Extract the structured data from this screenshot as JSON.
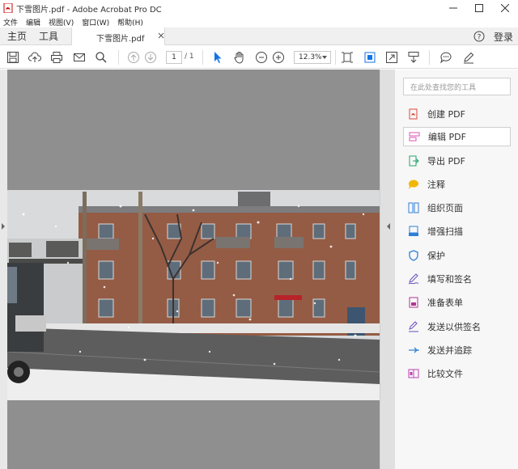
{
  "window": {
    "title": "下雪图片.pdf - Adobe Acrobat Pro DC"
  },
  "menu": [
    "文件",
    "编辑",
    "视图(V)",
    "窗口(W)",
    "帮助(H)"
  ],
  "tabs": {
    "home": "主页",
    "tools": "工具",
    "document": "下雪图片.pdf",
    "login": "登录"
  },
  "toolbar": {
    "current_page": "1",
    "total_pages": "/ 1",
    "zoom": "12.3%"
  },
  "tools_pane": {
    "search_placeholder": "在此处查找您的工具",
    "items": [
      {
        "label": "创建 PDF",
        "color": "#e0463b"
      },
      {
        "label": "编辑 PDF",
        "color": "#d854b4"
      },
      {
        "label": "导出 PDF",
        "color": "#27a36f"
      },
      {
        "label": "注释",
        "color": "#f2b705"
      },
      {
        "label": "组织页面",
        "color": "#2f7fd6"
      },
      {
        "label": "增强扫描",
        "color": "#2f7fd6"
      },
      {
        "label": "保护",
        "color": "#2f7fd6"
      },
      {
        "label": "填写和签名",
        "color": "#6a4fbf"
      },
      {
        "label": "准备表单",
        "color": "#b2368f"
      },
      {
        "label": "发送以供签名",
        "color": "#6a4fbf"
      },
      {
        "label": "发送并追踪",
        "color": "#2f7fd6"
      },
      {
        "label": "比较文件",
        "color": "#c23fb5"
      }
    ]
  },
  "document": {
    "image_description_icon": "snowy-street-photo",
    "sign_text": "□□□□□"
  },
  "colors": {
    "accent": "#1473e6",
    "doc_background": "#8f8f8f"
  }
}
